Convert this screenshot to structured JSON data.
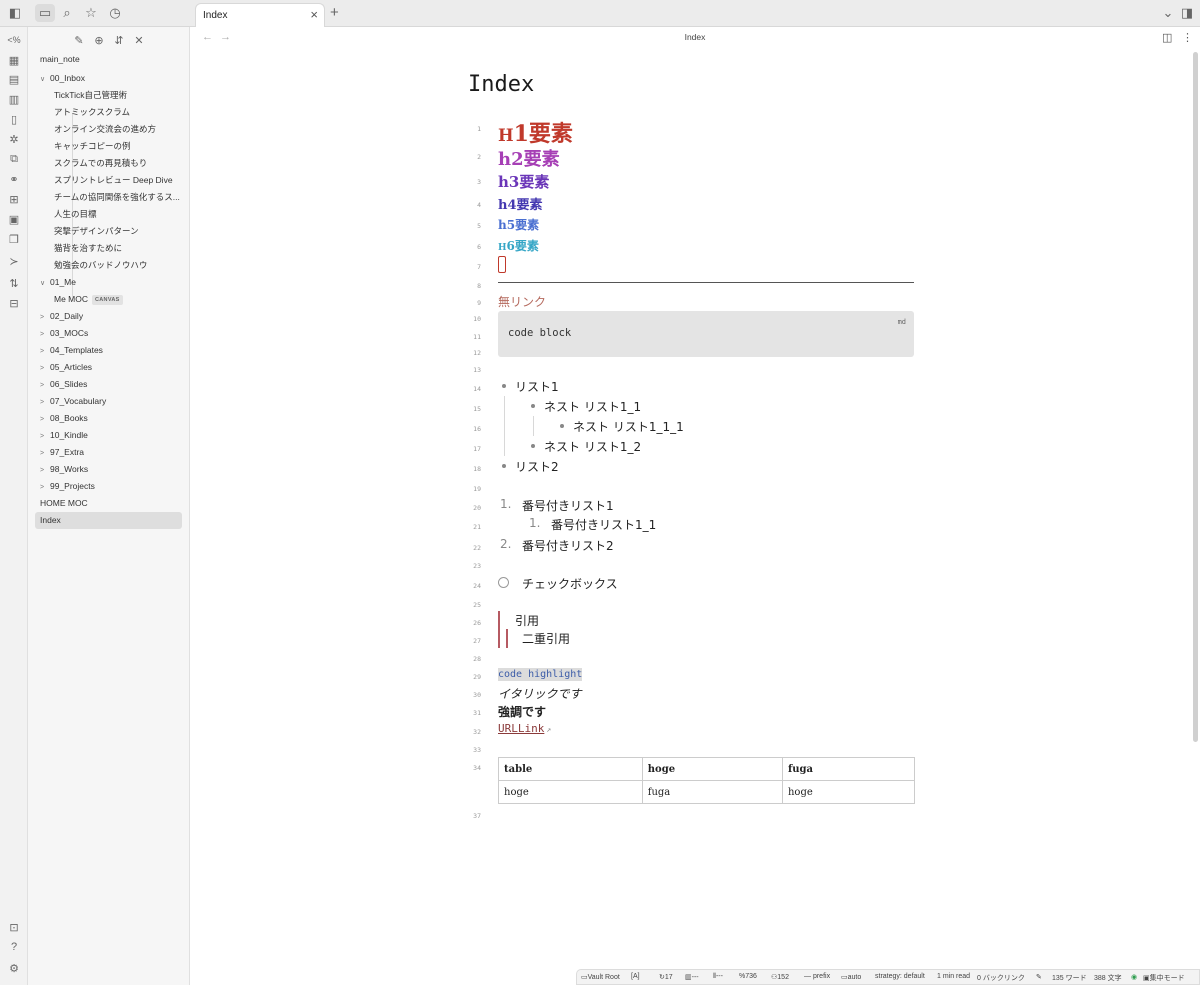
{
  "tab": {
    "title": "Index",
    "close": "×",
    "add": "+"
  },
  "view": {
    "title": "Index"
  },
  "sidebar": {
    "vault_root": "main_note",
    "items": [
      {
        "label": "00_Inbox",
        "chev": "∨",
        "level": 0
      },
      {
        "label": "TickTick自己管理術",
        "level": 1
      },
      {
        "label": "アトミックスクラム",
        "level": 1
      },
      {
        "label": "オンライン交流会の進め方",
        "level": 1
      },
      {
        "label": "キャッチコピーの例",
        "level": 1
      },
      {
        "label": "スクラムでの再見積もり",
        "level": 1
      },
      {
        "label": "スプリントレビュー Deep Dive",
        "level": 1
      },
      {
        "label": "チームの協同関係を強化するス...",
        "level": 1
      },
      {
        "label": "人生の目標",
        "level": 1
      },
      {
        "label": "突撃デザインパターン",
        "level": 1
      },
      {
        "label": "猫背を治すために",
        "level": 1
      },
      {
        "label": "勉強会のバッドノウハウ",
        "level": 1
      },
      {
        "label": "01_Me",
        "chev": "∨",
        "level": 0
      },
      {
        "label": "Me MOC",
        "badge": "CANVAS",
        "level": 1
      },
      {
        "label": "02_Daily",
        "chev": ">",
        "level": 0
      },
      {
        "label": "03_MOCs",
        "chev": ">",
        "level": 0
      },
      {
        "label": "04_Templates",
        "chev": ">",
        "level": 0
      },
      {
        "label": "05_Articles",
        "chev": ">",
        "level": 0
      },
      {
        "label": "06_Slides",
        "chev": ">",
        "level": 0
      },
      {
        "label": "07_Vocabulary",
        "chev": ">",
        "level": 0
      },
      {
        "label": "08_Books",
        "chev": ">",
        "level": 0
      },
      {
        "label": "10_Kindle",
        "chev": ">",
        "level": 0
      },
      {
        "label": "97_Extra",
        "chev": ">",
        "level": 0
      },
      {
        "label": "98_Works",
        "chev": ">",
        "level": 0
      },
      {
        "label": "99_Projects",
        "chev": ">",
        "level": 0
      },
      {
        "label": "HOME MOC",
        "level": 0
      },
      {
        "label": "Index",
        "level": 0,
        "active": true
      }
    ]
  },
  "editor": {
    "title": "Index",
    "line_numbers": [
      "1",
      "2",
      "3",
      "4",
      "5",
      "6",
      "7",
      "8",
      "9",
      "10",
      "11",
      "12",
      "13",
      "14",
      "15",
      "16",
      "17",
      "18",
      "19",
      "20",
      "21",
      "22",
      "23",
      "24",
      "25",
      "26",
      "27",
      "28",
      "29",
      "30",
      "31",
      "32",
      "33",
      "34",
      "37"
    ],
    "h1": {
      "mark": "H",
      "num": "1",
      "text": "要素"
    },
    "h2": "h2要素",
    "h3": "h3要素",
    "h4": "h4要素",
    "h5": "h5要素",
    "h6": {
      "mark": "H",
      "num": "6",
      "text": "要素"
    },
    "no_link": "無リンク",
    "code_lang": "md",
    "code_text": "code block",
    "list1": "リスト1",
    "nest1_1": "ネスト リスト1_1",
    "nest1_1_1": "ネスト リスト1_1_1",
    "nest1_2": "ネスト リスト1_2",
    "list2": "リスト2",
    "ol1_marker": "1.",
    "ol1": "番号付きリスト1",
    "ol1_1_marker": "1.",
    "ol1_1": "番号付きリスト1_1",
    "ol2_marker": "2.",
    "ol2": "番号付きリスト2",
    "checkbox": "チェックボックス",
    "quote": "引用",
    "quote2": "二重引用",
    "code_highlight": "code highlight",
    "italic": "イタリックです",
    "bold": "強調です",
    "url_link": "URLLink",
    "table": {
      "headers": [
        "table",
        "hoge",
        "fuga"
      ],
      "rows": [
        [
          "hoge",
          "fuga",
          "hoge"
        ]
      ]
    }
  },
  "status": {
    "vault": "Vault Root",
    "mode": "[A]",
    "s1": "17",
    "s2": "---",
    "s3": "---",
    "s4": "736",
    "s5": "152",
    "prefix": "prefix",
    "auto": "auto",
    "strategy": "strategy: default",
    "read": "1 min read",
    "backlinks": "0 バックリンク",
    "words": "135 ワード",
    "chars": "388 文字",
    "focus": "集中モード"
  },
  "colors": {
    "h1": "#c0392b",
    "h2": "#a63fb5",
    "h3": "#6a35b8",
    "h4": "#4438b0",
    "h5": "#4a6fd1",
    "h6": "#35a6c6"
  }
}
